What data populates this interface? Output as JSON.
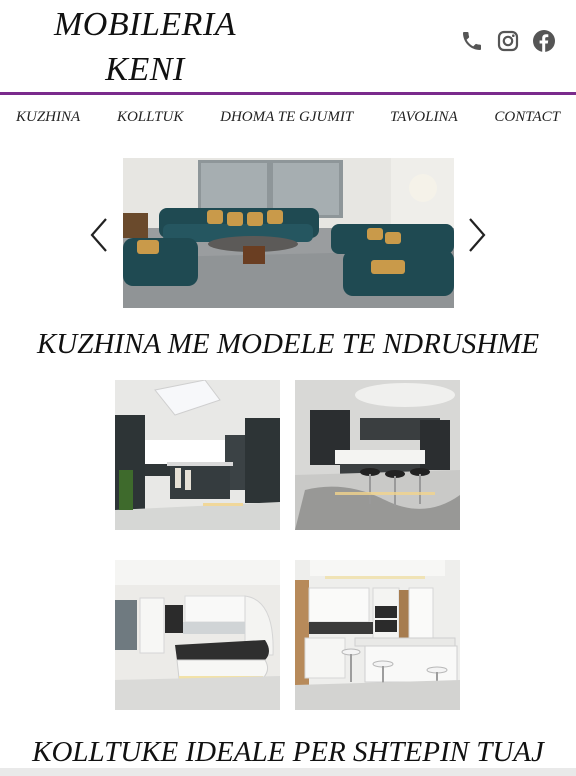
{
  "header": {
    "logo_line1": "MOBILERIA",
    "logo_line2": "KENI",
    "social": [
      "phone-icon",
      "instagram-icon",
      "facebook-icon"
    ]
  },
  "colors": {
    "accent": "#7a2a8c",
    "icon": "#555555"
  },
  "nav": {
    "items": [
      {
        "label": "KUZHINA"
      },
      {
        "label": "KOLLTUK"
      },
      {
        "label": "DHOMA TE GJUMIT"
      },
      {
        "label": "TAVOLINA"
      },
      {
        "label": "CONTACT"
      }
    ]
  },
  "slider": {
    "slides": 2,
    "active_slide": 1
  },
  "sections": [
    {
      "title": "KUZHINA ME MODELE TE NDRUSHME"
    },
    {
      "title": "KOLLTUKE IDEALE PER SHTEPIN TUAJ"
    }
  ]
}
